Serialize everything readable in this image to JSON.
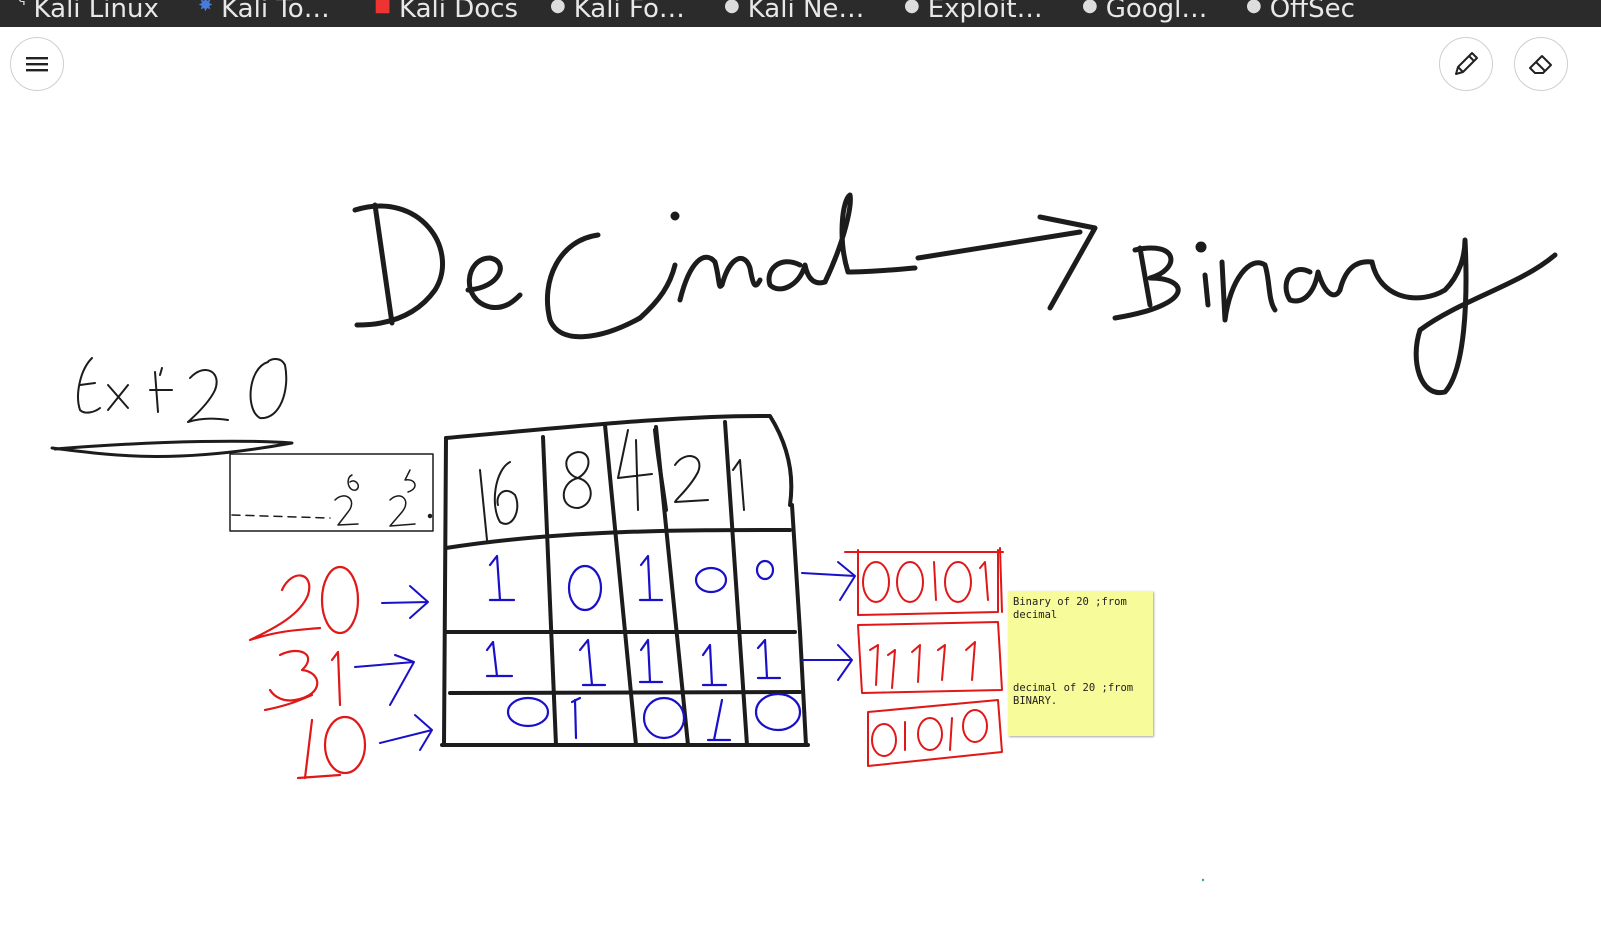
{
  "bookmarks": [
    {
      "label": "Kali Linux",
      "icon": "kali-dragon-icon"
    },
    {
      "label": "Kali To…",
      "icon": "kali-tools-icon"
    },
    {
      "label": "Kali Docs",
      "icon": "kali-docs-icon"
    },
    {
      "label": "Kali Fo…",
      "icon": "globe-icon"
    },
    {
      "label": "Kali Ne…",
      "icon": "globe-icon"
    },
    {
      "label": "Exploit…",
      "icon": "globe-icon"
    },
    {
      "label": "Googl…",
      "icon": "globe-icon"
    },
    {
      "label": "OffSec",
      "icon": "globe-icon"
    }
  ],
  "toolbar": {
    "menu_icon": "hamburger-menu-icon",
    "pen_icon": "pencil-icon",
    "eraser_icon": "eraser-icon"
  },
  "drawing": {
    "title": "Decimal → Binary",
    "example": "Ex: 20",
    "powers_note": "2⁶ 2⁵",
    "place_values": [
      "16",
      "8",
      "4",
      "2",
      "1"
    ],
    "rows": [
      {
        "decimal": "20",
        "bits": [
          "1",
          "0",
          "1",
          "0",
          "0"
        ],
        "result": "00101"
      },
      {
        "decimal": "31",
        "bits": [
          "1",
          "1",
          "1",
          "1",
          "1"
        ],
        "result": "11111"
      },
      {
        "decimal": "10",
        "bits": [
          "0",
          "1",
          "0",
          "1",
          "0"
        ],
        "result": "01010"
      }
    ],
    "colors": {
      "black_ink": "#1c1c1c",
      "blue_ink": "#1a10c8",
      "red_ink": "#e01818",
      "sticky": "#f7fb9a"
    }
  },
  "sticky_note": {
    "line1": "Binary of 20 ;from decimal",
    "line2": "decimal of 20 ;from BINARY."
  }
}
